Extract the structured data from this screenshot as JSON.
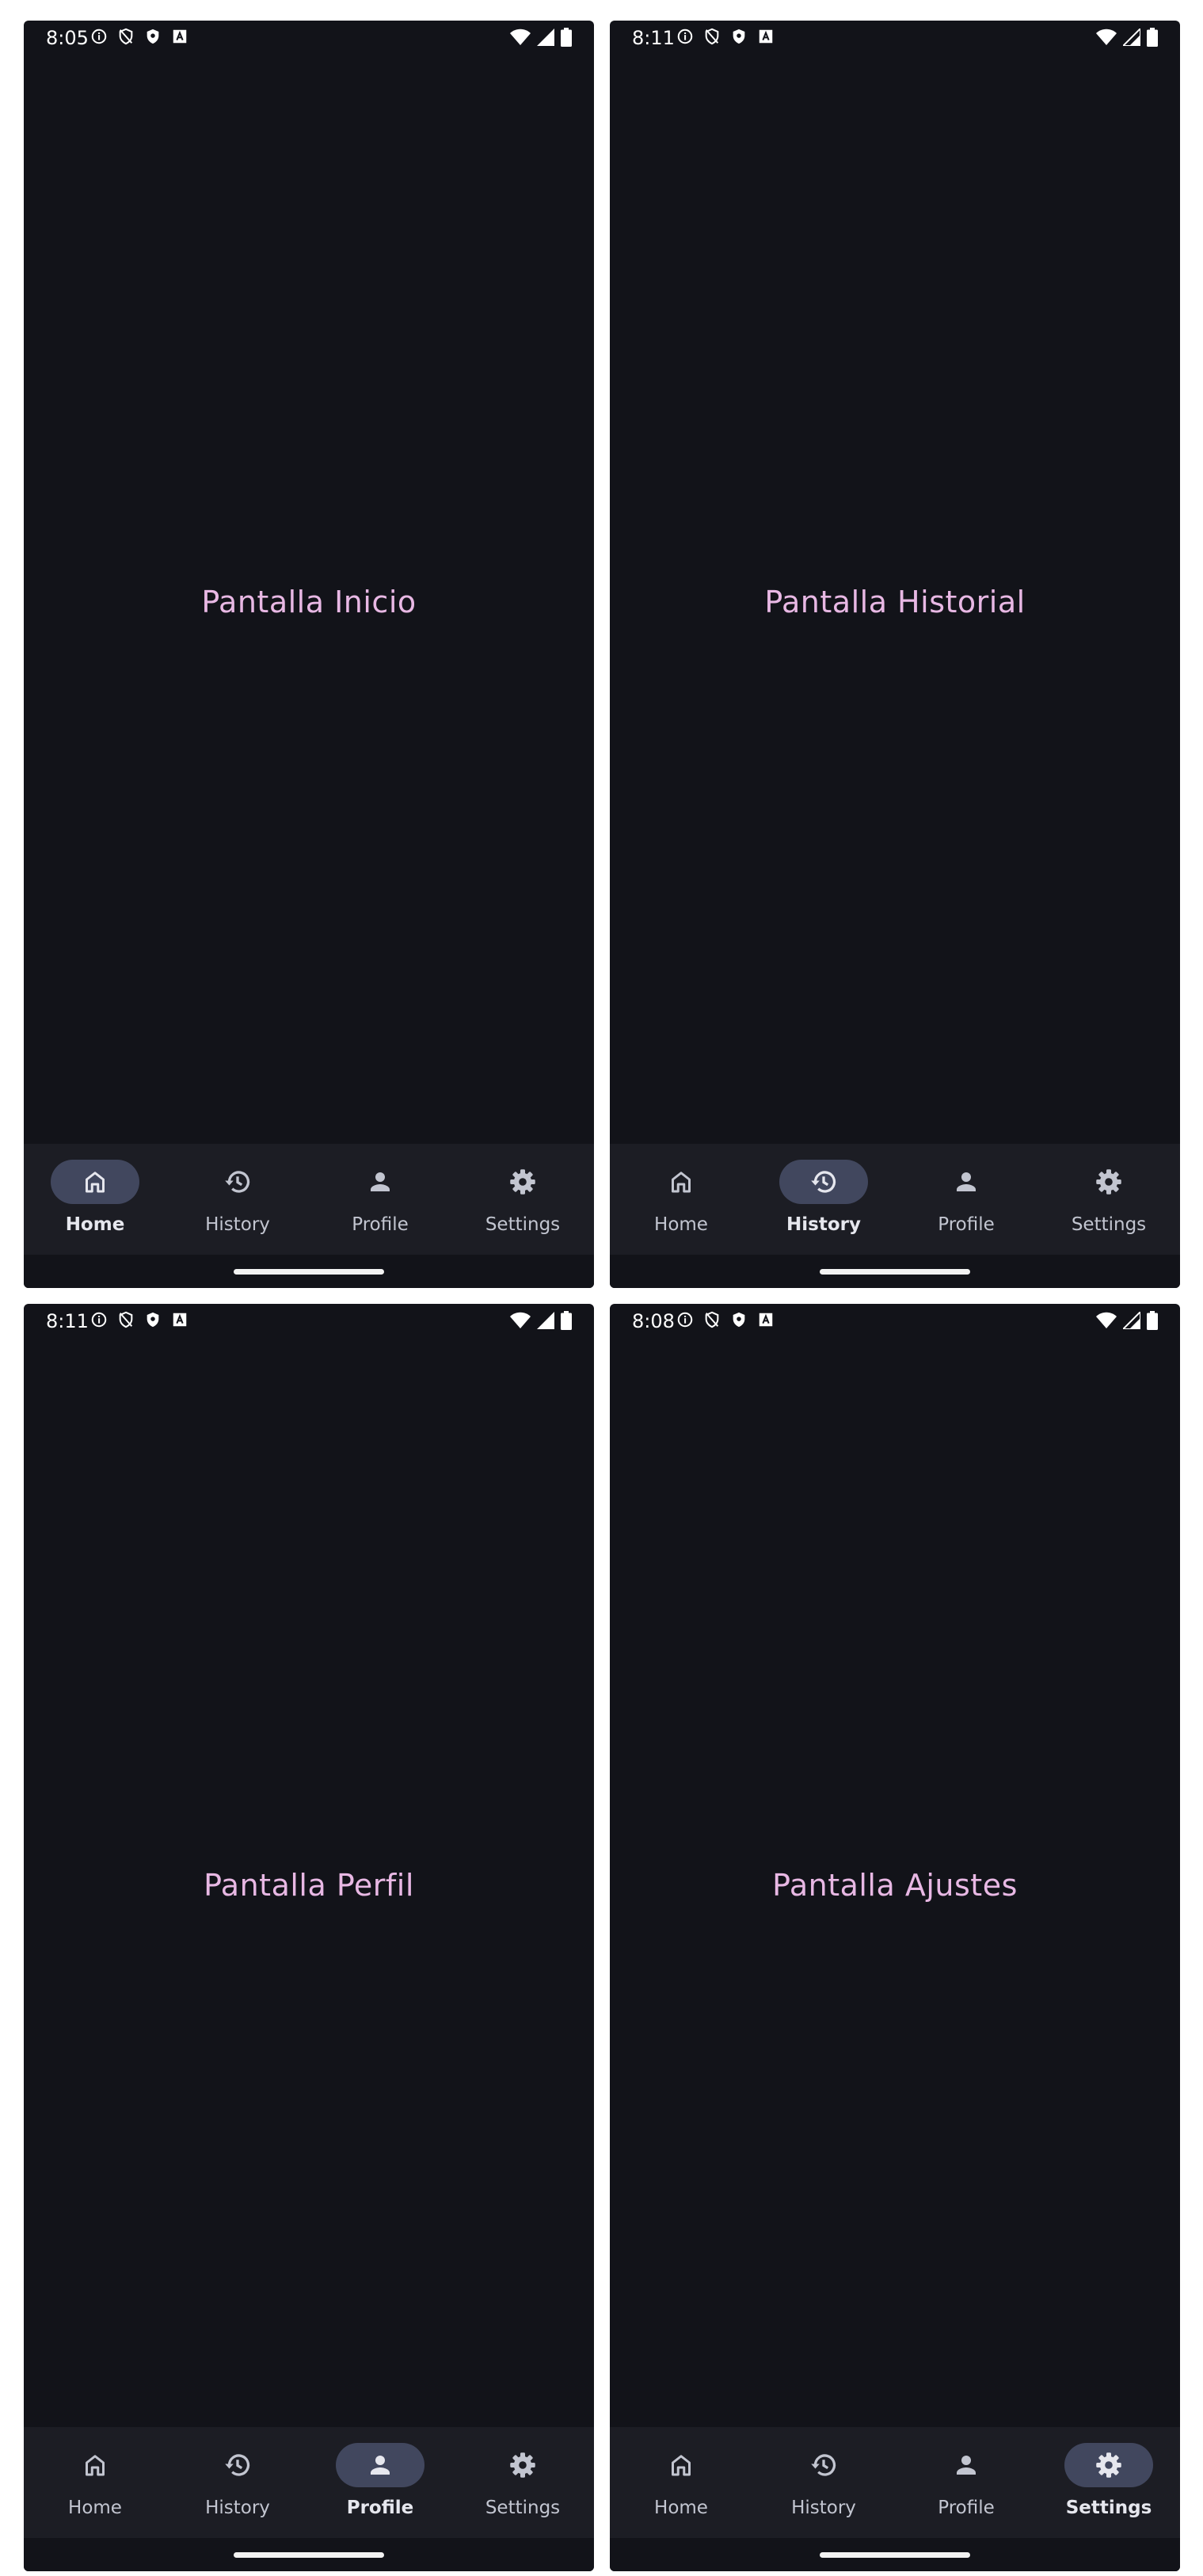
{
  "nav_labels": {
    "home": "Home",
    "history": "History",
    "profile": "Profile",
    "settings": "Settings"
  },
  "colors": {
    "background": "#121319",
    "nav_bar": "#1c1d24",
    "active_pill": "#41475e",
    "title_text": "#e8b8e4",
    "nav_text": "#c2c5d0"
  },
  "screens": [
    {
      "time": "8:05",
      "title": "Pantalla Inicio",
      "active_tab": "home"
    },
    {
      "time": "8:11",
      "title": "Pantalla Historial",
      "active_tab": "history"
    },
    {
      "time": "8:11",
      "title": "Pantalla Perfil",
      "active_tab": "profile"
    },
    {
      "time": "8:08",
      "title": "Pantalla Ajustes",
      "active_tab": "settings"
    }
  ],
  "status_icons_left": [
    "info-icon",
    "shield-slash-icon",
    "shield-icon",
    "font-a-icon"
  ],
  "status_icons_right": [
    "wifi-icon",
    "cell-signal-icon",
    "battery-icon"
  ],
  "nav_icons": {
    "home": "home-icon",
    "history": "history-icon",
    "profile": "person-icon",
    "settings": "gear-icon"
  }
}
